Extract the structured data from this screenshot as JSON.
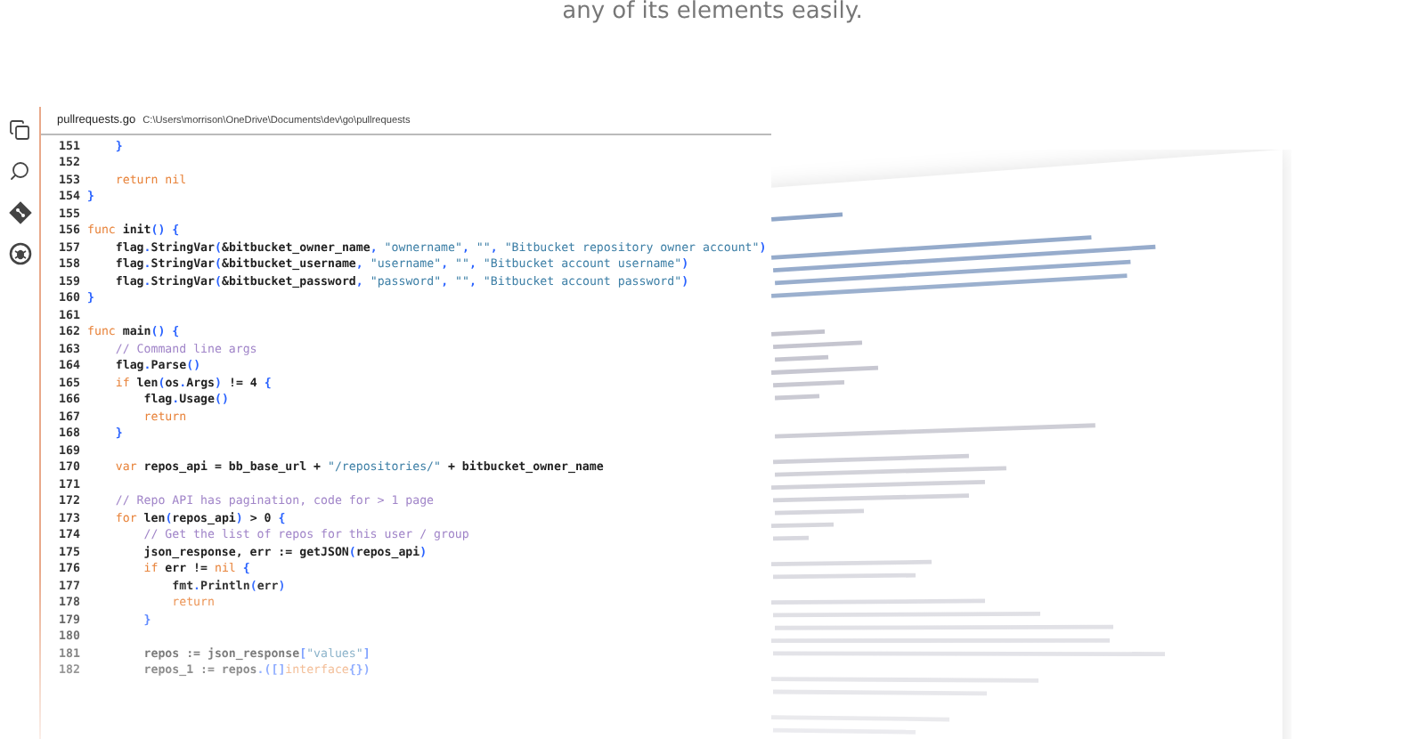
{
  "caption": "any of its elements easily.",
  "sidebar": {
    "items": [
      {
        "kind": "files"
      },
      {
        "kind": "search"
      },
      {
        "kind": "git"
      },
      {
        "kind": "debug"
      }
    ]
  },
  "editor": {
    "file_name": "pullrequests.go",
    "file_path": "C:\\Users\\morrison\\OneDrive\\Documents\\dev\\go\\pullrequests",
    "lines": [
      {
        "number": "151",
        "tokens": [
          {
            "kind": "punct",
            "text": "    }"
          }
        ]
      },
      {
        "number": "152"
      },
      {
        "number": "153",
        "tokens": [
          {
            "kind": "keyword",
            "text": "    return nil"
          }
        ]
      },
      {
        "number": "154",
        "tokens": [
          {
            "kind": "punct",
            "text": "}"
          }
        ]
      },
      {
        "number": "155"
      },
      {
        "number": "156",
        "tokens": [
          {
            "kind": "keyword",
            "text": "func"
          },
          {
            "kind": "plain",
            "text": " init"
          },
          {
            "kind": "punct",
            "text": "() {"
          }
        ]
      },
      {
        "number": "157",
        "tokens": [
          {
            "kind": "plain",
            "text": "    flag"
          },
          {
            "kind": "punct",
            "text": "."
          },
          {
            "kind": "plain",
            "text": "StringVar"
          },
          {
            "kind": "punct",
            "text": "("
          },
          {
            "kind": "plain",
            "text": "&bitbucket_owner_name"
          },
          {
            "kind": "punct",
            "text": ", "
          },
          {
            "kind": "string",
            "text": "\"ownername\""
          },
          {
            "kind": "punct",
            "text": ", "
          },
          {
            "kind": "string",
            "text": "\"\""
          },
          {
            "kind": "punct",
            "text": ", "
          },
          {
            "kind": "string",
            "text": "\"Bitbucket repository owner account\""
          },
          {
            "kind": "punct",
            "text": ")"
          }
        ]
      },
      {
        "number": "158",
        "tokens": [
          {
            "kind": "plain",
            "text": "    flag"
          },
          {
            "kind": "punct",
            "text": "."
          },
          {
            "kind": "plain",
            "text": "StringVar"
          },
          {
            "kind": "punct",
            "text": "("
          },
          {
            "kind": "plain",
            "text": "&bitbucket_username"
          },
          {
            "kind": "punct",
            "text": ", "
          },
          {
            "kind": "string",
            "text": "\"username\""
          },
          {
            "kind": "punct",
            "text": ", "
          },
          {
            "kind": "string",
            "text": "\"\""
          },
          {
            "kind": "punct",
            "text": ", "
          },
          {
            "kind": "string",
            "text": "\"Bitbucket account username\""
          },
          {
            "kind": "punct",
            "text": ")"
          }
        ]
      },
      {
        "number": "159",
        "tokens": [
          {
            "kind": "plain",
            "text": "    flag"
          },
          {
            "kind": "punct",
            "text": "."
          },
          {
            "kind": "plain",
            "text": "StringVar"
          },
          {
            "kind": "punct",
            "text": "("
          },
          {
            "kind": "plain",
            "text": "&bitbucket_password"
          },
          {
            "kind": "punct",
            "text": ", "
          },
          {
            "kind": "string",
            "text": "\"password\""
          },
          {
            "kind": "punct",
            "text": ", "
          },
          {
            "kind": "string",
            "text": "\"\""
          },
          {
            "kind": "punct",
            "text": ", "
          },
          {
            "kind": "string",
            "text": "\"Bitbucket account password\""
          },
          {
            "kind": "punct",
            "text": ")"
          }
        ]
      },
      {
        "number": "160",
        "tokens": [
          {
            "kind": "punct",
            "text": "}"
          }
        ]
      },
      {
        "number": "161"
      },
      {
        "number": "162",
        "tokens": [
          {
            "kind": "keyword",
            "text": "func"
          },
          {
            "kind": "plain",
            "text": " main"
          },
          {
            "kind": "punct",
            "text": "() {"
          }
        ]
      },
      {
        "number": "163",
        "tokens": [
          {
            "kind": "comment",
            "text": "    // Command line args"
          }
        ]
      },
      {
        "number": "164",
        "tokens": [
          {
            "kind": "plain",
            "text": "    flag"
          },
          {
            "kind": "punct",
            "text": "."
          },
          {
            "kind": "plain",
            "text": "Parse"
          },
          {
            "kind": "punct",
            "text": "()"
          }
        ]
      },
      {
        "number": "165",
        "tokens": [
          {
            "kind": "keyword",
            "text": "    if"
          },
          {
            "kind": "plain",
            "text": " len"
          },
          {
            "kind": "punct",
            "text": "("
          },
          {
            "kind": "plain",
            "text": "os"
          },
          {
            "kind": "punct",
            "text": "."
          },
          {
            "kind": "plain",
            "text": "Args"
          },
          {
            "kind": "punct",
            "text": ")"
          },
          {
            "kind": "plain",
            "text": " != 4 "
          },
          {
            "kind": "punct",
            "text": "{"
          }
        ]
      },
      {
        "number": "166",
        "tokens": [
          {
            "kind": "plain",
            "text": "        flag"
          },
          {
            "kind": "punct",
            "text": "."
          },
          {
            "kind": "plain",
            "text": "Usage"
          },
          {
            "kind": "punct",
            "text": "()"
          }
        ]
      },
      {
        "number": "167",
        "tokens": [
          {
            "kind": "keyword",
            "text": "        return"
          }
        ]
      },
      {
        "number": "168",
        "tokens": [
          {
            "kind": "punct",
            "text": "    }"
          }
        ]
      },
      {
        "number": "169"
      },
      {
        "number": "170",
        "tokens": [
          {
            "kind": "keyword",
            "text": "    var"
          },
          {
            "kind": "plain",
            "text": " repos_api = bb_base_url + "
          },
          {
            "kind": "string",
            "text": "\"/repositories/\""
          },
          {
            "kind": "plain",
            "text": " + bitbucket_owner_name"
          }
        ]
      },
      {
        "number": "171"
      },
      {
        "number": "172",
        "tokens": [
          {
            "kind": "comment",
            "text": "    // Repo API has pagination, code for > 1 page"
          }
        ]
      },
      {
        "number": "173",
        "tokens": [
          {
            "kind": "keyword",
            "text": "    for"
          },
          {
            "kind": "plain",
            "text": " len"
          },
          {
            "kind": "punct",
            "text": "("
          },
          {
            "kind": "plain",
            "text": "repos_api"
          },
          {
            "kind": "punct",
            "text": ")"
          },
          {
            "kind": "plain",
            "text": " > 0 "
          },
          {
            "kind": "punct",
            "text": "{"
          }
        ]
      },
      {
        "number": "174",
        "tokens": [
          {
            "kind": "comment",
            "text": "        // Get the list of repos for this user / group"
          }
        ]
      },
      {
        "number": "175",
        "tokens": [
          {
            "kind": "plain",
            "text": "        json_response, err := getJSON"
          },
          {
            "kind": "punct",
            "text": "("
          },
          {
            "kind": "plain",
            "text": "repos_api"
          },
          {
            "kind": "punct",
            "text": ")"
          }
        ]
      },
      {
        "number": "176",
        "tokens": [
          {
            "kind": "keyword",
            "text": "        if"
          },
          {
            "kind": "plain",
            "text": " err != "
          },
          {
            "kind": "keyword",
            "text": "nil"
          },
          {
            "kind": "punct",
            "text": " {"
          }
        ]
      },
      {
        "number": "177",
        "tokens": [
          {
            "kind": "plain",
            "text": "            fmt"
          },
          {
            "kind": "punct",
            "text": "."
          },
          {
            "kind": "plain",
            "text": "Println"
          },
          {
            "kind": "punct",
            "text": "("
          },
          {
            "kind": "plain",
            "text": "err"
          },
          {
            "kind": "punct",
            "text": ")"
          }
        ]
      },
      {
        "number": "178",
        "tokens": [
          {
            "kind": "keyword",
            "text": "            return"
          }
        ]
      },
      {
        "number": "179",
        "tokens": [
          {
            "kind": "punct",
            "text": "        }"
          }
        ]
      },
      {
        "number": "180"
      },
      {
        "number": "181",
        "tokens": [
          {
            "kind": "plain",
            "text": "        repos := json_response"
          },
          {
            "kind": "punct",
            "text": "["
          },
          {
            "kind": "string",
            "text": "\"values\""
          },
          {
            "kind": "punct",
            "text": "]"
          }
        ]
      },
      {
        "number": "182",
        "tokens": [
          {
            "kind": "plain",
            "text": "        repos_1 := repos"
          },
          {
            "kind": "punct",
            "text": ".([]"
          },
          {
            "kind": "keyword",
            "text": "interface"
          },
          {
            "kind": "punct",
            "text": "{})"
          }
        ]
      }
    ]
  }
}
